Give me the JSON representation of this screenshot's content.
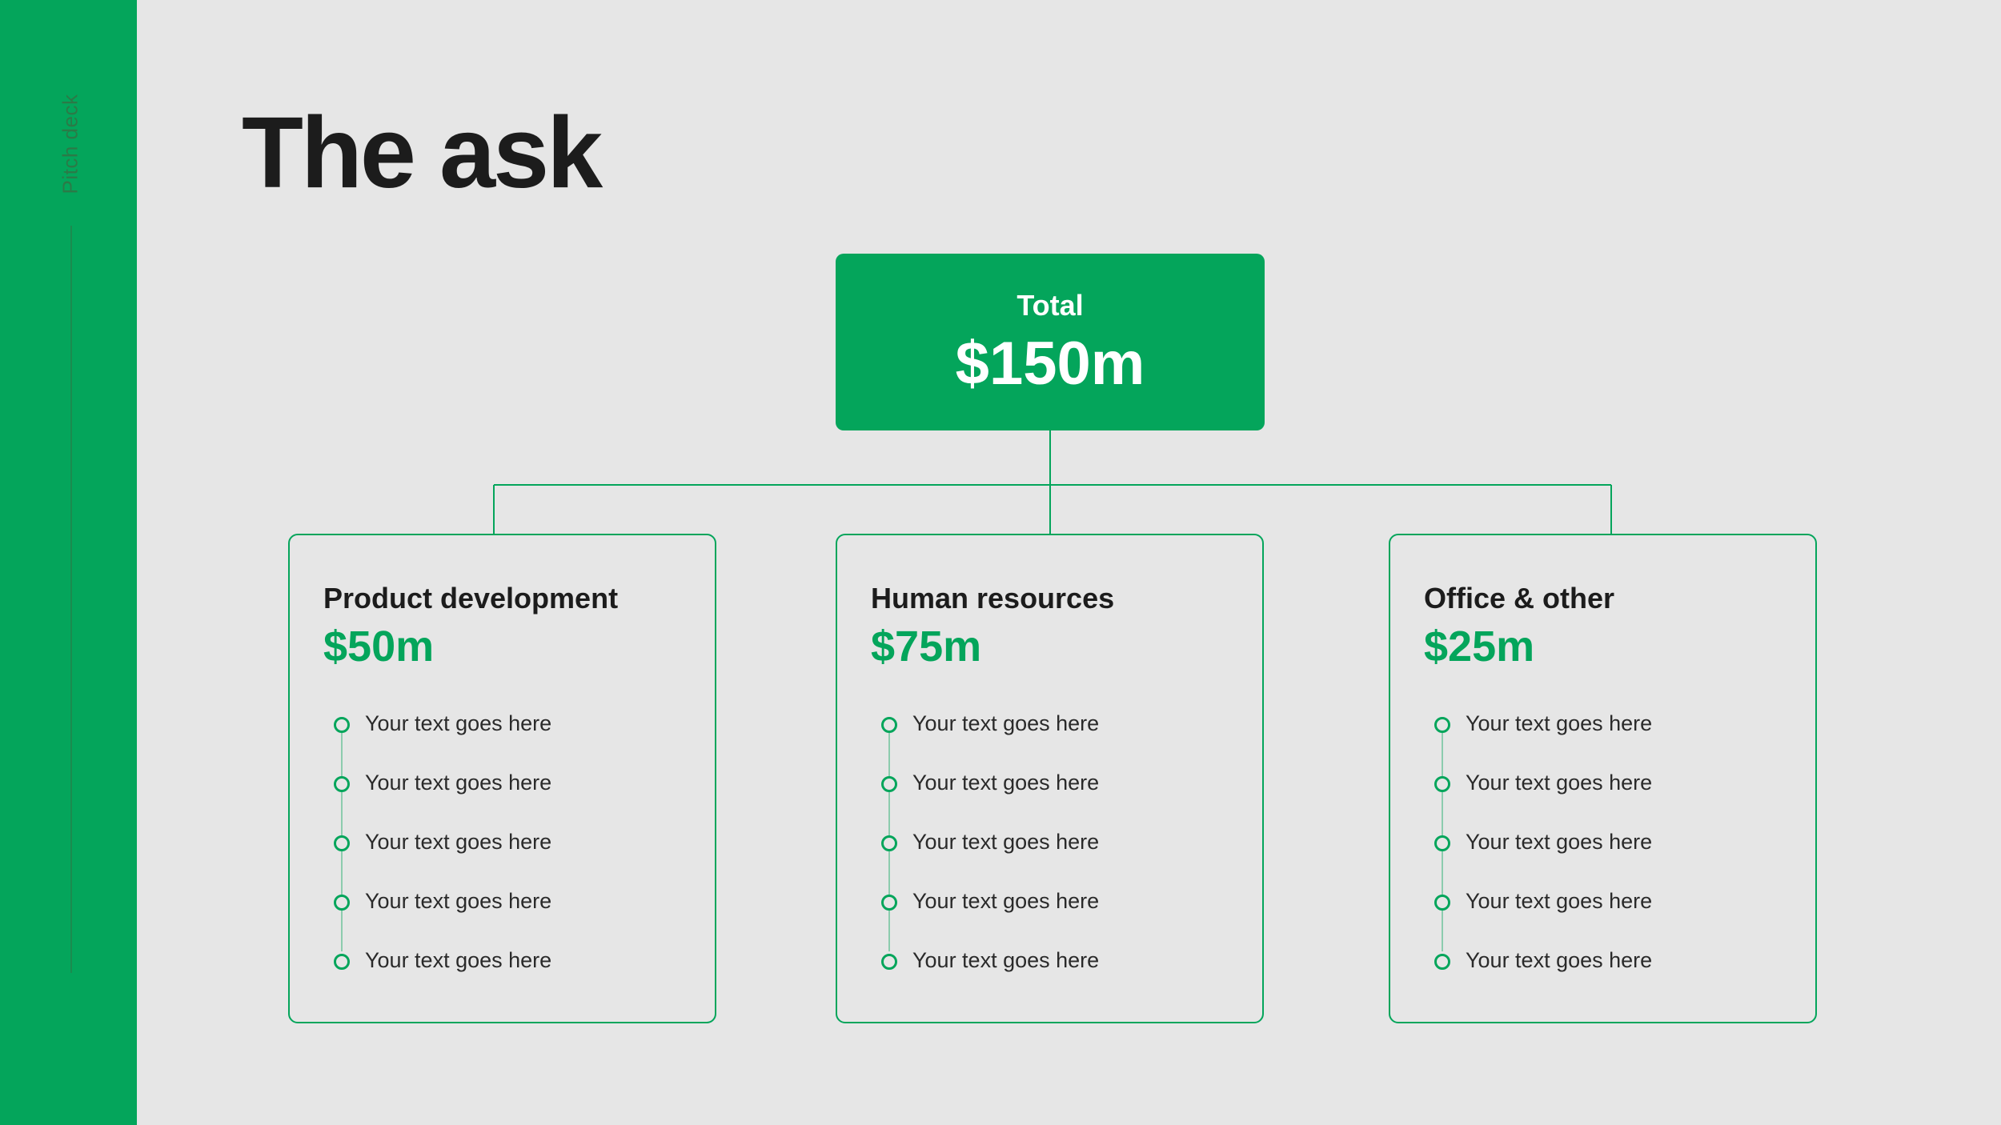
{
  "sidebar": {
    "label": "Pitch deck"
  },
  "title": "The ask",
  "total": {
    "label": "Total",
    "value": "$150m"
  },
  "cards": [
    {
      "title": "Product development",
      "amount": "$50m",
      "items": [
        "Your text goes here",
        "Your text goes here",
        "Your text goes here",
        "Your text goes here",
        "Your text goes here"
      ]
    },
    {
      "title": "Human resources",
      "amount": "$75m",
      "items": [
        "Your text goes here",
        "Your text goes here",
        "Your text goes here",
        "Your text goes here",
        "Your text goes here"
      ]
    },
    {
      "title": "Office & other",
      "amount": "$25m",
      "items": [
        "Your text goes here",
        "Your text goes here",
        "Your text goes here",
        "Your text goes here",
        "Your text goes here"
      ]
    }
  ],
  "colors": {
    "accent": "#04a55b",
    "background": "#e6e6e6",
    "text": "#1c1c1c"
  }
}
